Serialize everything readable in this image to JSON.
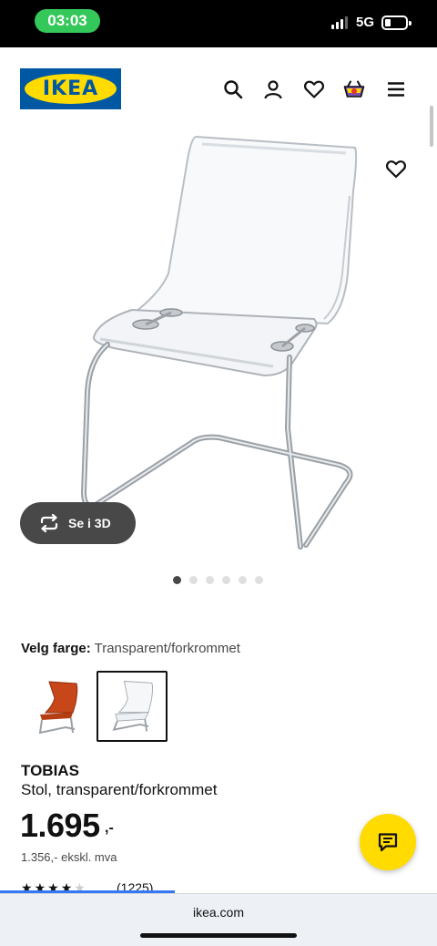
{
  "status_bar": {
    "time": "03:03",
    "network": "5G"
  },
  "header": {
    "logo_text": "IKEA",
    "icons": [
      "search-icon",
      "account-icon",
      "heart-icon",
      "basket-icon",
      "menu-icon"
    ]
  },
  "gallery": {
    "view_3d_label": "Se i 3D",
    "image_count": 6,
    "active_index": 0
  },
  "color_picker": {
    "label": "Velg farge:",
    "selected_value": "Transparent/forkrommet",
    "options": [
      "orange",
      "transparent"
    ],
    "selected_index": 1
  },
  "product": {
    "name": "TOBIAS",
    "description": "Stol, transparent/forkrommet",
    "price": "1.695",
    "price_suffix": ",-",
    "vat_note": "1.356,- ekskl. mva",
    "rating": 4,
    "reviews": "(1225)"
  },
  "browser": {
    "url": "ikea.com",
    "load_progress": 0.4
  },
  "colors": {
    "ikea_blue": "#0058a3",
    "ikea_yellow": "#ffdb00",
    "status_green": "#34c759"
  }
}
